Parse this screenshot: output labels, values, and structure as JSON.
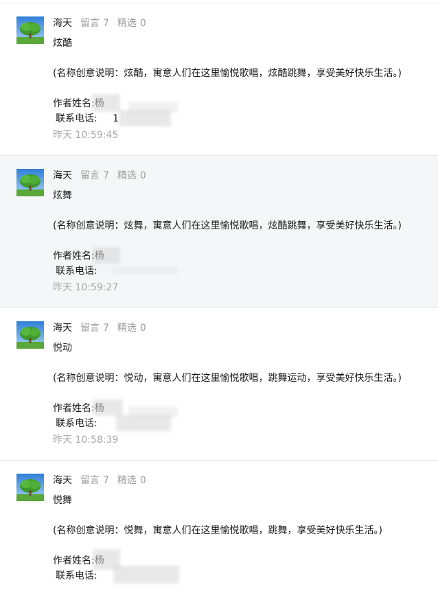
{
  "comments": [
    {
      "nickname": "海天",
      "reply_label": "留言",
      "reply_count": "7",
      "featured_label": "精选",
      "featured_count": "0",
      "title": "炫酷",
      "description": "(名称创意说明：炫酷，寓意人们在这里愉悦歌唱，炫酷跳舞，享受美好快乐生活。)",
      "author_label": "作者姓名:杨",
      "phone_label": "联系电话:",
      "phone_fragment": "1",
      "time": "昨天 10:59:45",
      "highlighted": false
    },
    {
      "nickname": "海天",
      "reply_label": "留言",
      "reply_count": "7",
      "featured_label": "精选",
      "featured_count": "0",
      "title": "炫舞",
      "description": "(名称创意说明：炫舞，寓意人们在这里愉悦歌唱，炫酷跳舞，享受美好快乐生活。)",
      "author_label": "作者姓名:杨",
      "phone_label": "联系电话:",
      "phone_fragment": "",
      "time": "昨天 10:59:27",
      "highlighted": true
    },
    {
      "nickname": "海天",
      "reply_label": "留言",
      "reply_count": "7",
      "featured_label": "精选",
      "featured_count": "0",
      "title": "悦动",
      "description": "(名称创意说明：悦动，寓意人们在这里愉悦歌唱，跳舞运动，享受美好快乐生活。)",
      "author_label": "作者姓名:杨",
      "phone_label": "联系电话:",
      "phone_fragment": "",
      "time": "昨天 10:58:39",
      "highlighted": false
    },
    {
      "nickname": "海天",
      "reply_label": "留言",
      "reply_count": "7",
      "featured_label": "精选",
      "featured_count": "0",
      "title": "悦舞",
      "description": "(名称创意说明：悦舞，寓意人们在这里愉悦歌唱，跳舞，享受美好快乐生活。)",
      "author_label": "作者姓名:杨",
      "phone_label": "联系电话:",
      "phone_fragment": "",
      "time": "",
      "highlighted": false
    }
  ],
  "colors": {
    "text": "#1a1a1a",
    "muted": "#9b9b9b",
    "highlight_bg": "#f5f6f8",
    "divider": "#e6e6e6"
  },
  "icons": {
    "avatar": "tree-avatar-icon"
  }
}
